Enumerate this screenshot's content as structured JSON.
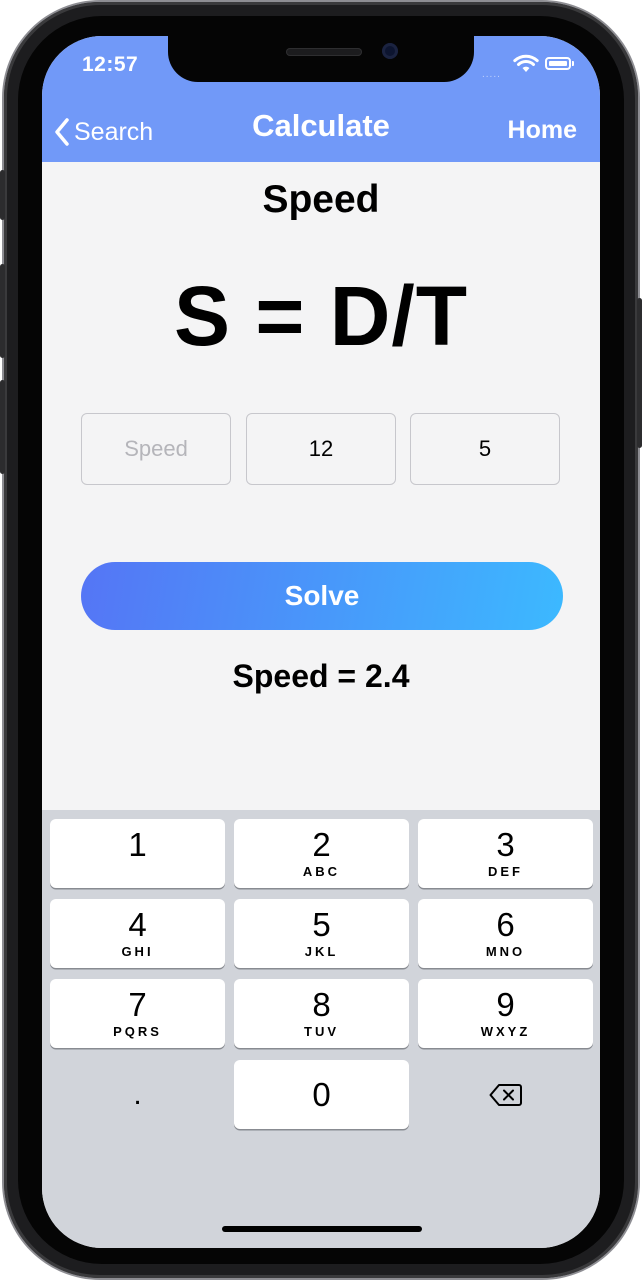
{
  "status_bar": {
    "time": "12:57",
    "signal": "....."
  },
  "nav": {
    "back_label": "Search",
    "title": "Calculate",
    "home_label": "Home"
  },
  "content": {
    "heading": "Speed",
    "formula": "S = D/T",
    "inputs": [
      {
        "value": "",
        "placeholder": "Speed"
      },
      {
        "value": "12",
        "placeholder": ""
      },
      {
        "value": "5",
        "placeholder": ""
      }
    ],
    "solve_label": "Solve",
    "result": "Speed = 2.4"
  },
  "keyboard": {
    "keys": [
      {
        "num": "1",
        "letters": ""
      },
      {
        "num": "2",
        "letters": "ABC"
      },
      {
        "num": "3",
        "letters": "DEF"
      },
      {
        "num": "4",
        "letters": "GHI"
      },
      {
        "num": "5",
        "letters": "JKL"
      },
      {
        "num": "6",
        "letters": "MNO"
      },
      {
        "num": "7",
        "letters": "PQRS"
      },
      {
        "num": "8",
        "letters": "TUV"
      },
      {
        "num": "9",
        "letters": "WXYZ"
      }
    ],
    "decimal": ".",
    "zero": "0",
    "delete_icon": "delete-backspace"
  },
  "colors": {
    "nav_bar": "#7199f8",
    "solve_gradient_start": "#5575f5",
    "solve_gradient_end": "#3cb9ff",
    "keyboard_bg": "#d1d4da"
  }
}
